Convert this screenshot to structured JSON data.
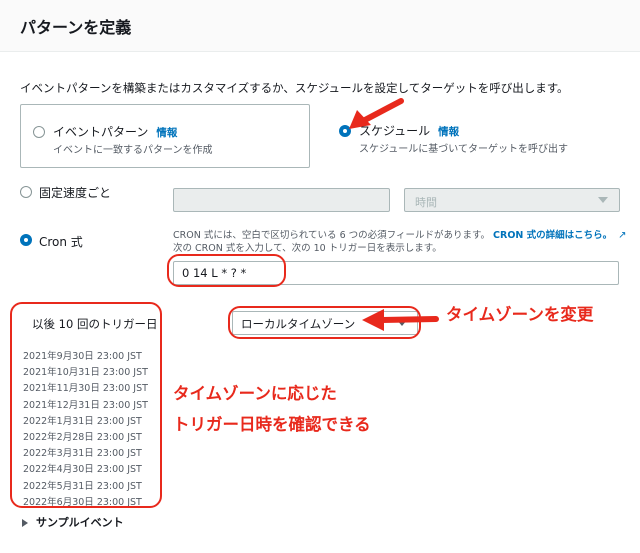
{
  "header": {
    "title": "パターンを定義"
  },
  "description": "イベントパターンを構築またはカスタマイズするか、スケジュールを設定してターゲットを呼び出します。",
  "options": {
    "event_pattern": {
      "label": "イベントパターン",
      "info": "情報",
      "subtitle": "イベントに一致するパターンを作成",
      "selected": false
    },
    "schedule": {
      "label": "スケジュール",
      "info": "情報",
      "subtitle": "スケジュールに基づいてターゲットを呼び出す",
      "selected": true
    }
  },
  "schedule": {
    "fixed_rate": {
      "label": "固定速度ごと",
      "value": "",
      "unit": "時間",
      "selected": false
    },
    "cron": {
      "label": "Cron 式",
      "selected": true,
      "help_line1": "CRON 式には、空白で区切られている 6 つの必須フィールドがあります。",
      "help_link": "CRON 式の詳細はこちら。",
      "help_line2": "次の CRON 式を入力して、次の 10 トリガー日を表示します。",
      "value": "0 14 L * ? *"
    }
  },
  "triggers": {
    "title": "以後 10 回のトリガー日",
    "timezone": "ローカルタイムゾーン",
    "dates": [
      "2021年9月30日 23:00 JST",
      "2021年10月31日 23:00 JST",
      "2021年11月30日 23:00 JST",
      "2021年12月31日 23:00 JST",
      "2022年1月31日 23:00 JST",
      "2022年2月28日 23:00 JST",
      "2022年3月31日 23:00 JST",
      "2022年4月30日 23:00 JST",
      "2022年5月31日 23:00 JST",
      "2022年6月30日 23:00 JST"
    ]
  },
  "sample_event": {
    "label": "サンプルイベント"
  },
  "annotations": {
    "timezone_change": "タイムゾーンを変更",
    "line1": "タイムゾーンに応じた",
    "line2": "トリガー日時を確認できる"
  },
  "colors": {
    "accent": "#0073bb",
    "annotation": "#e8291c"
  }
}
